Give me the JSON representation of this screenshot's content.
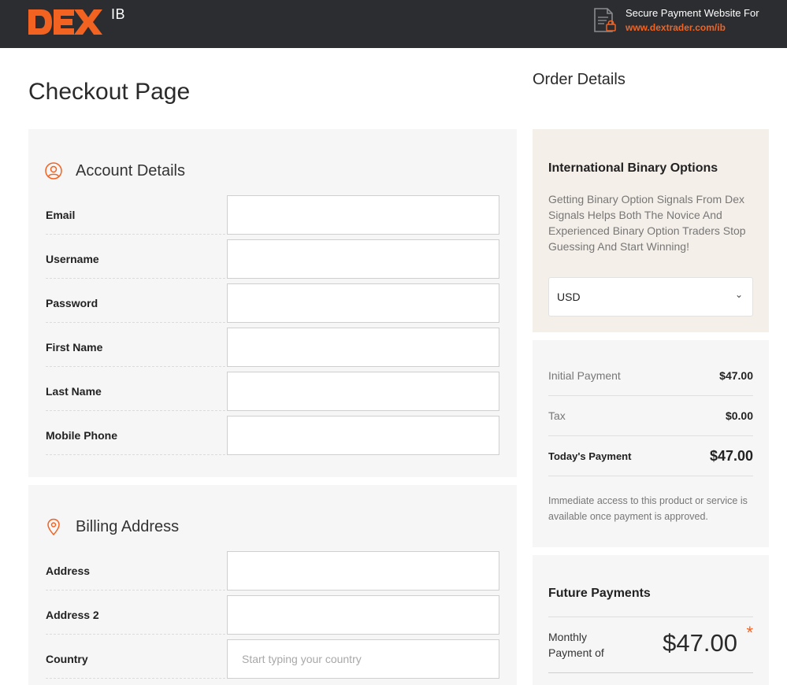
{
  "header": {
    "logo_text": "DEX",
    "logo_sub": "IB",
    "secure_text": "Secure Payment Website For",
    "secure_url": "www.dextrader.com/ib",
    "accent_color": "#f26322"
  },
  "page": {
    "title": "Checkout Page",
    "order_title": "Order Details"
  },
  "account": {
    "heading": "Account Details",
    "icon": "user-circle-icon",
    "fields": [
      {
        "label": "Email",
        "value": "",
        "placeholder": ""
      },
      {
        "label": "Username",
        "value": "",
        "placeholder": ""
      },
      {
        "label": "Password",
        "value": "",
        "placeholder": ""
      },
      {
        "label": "First Name",
        "value": "",
        "placeholder": ""
      },
      {
        "label": "Last Name",
        "value": "",
        "placeholder": ""
      },
      {
        "label": "Mobile Phone",
        "value": "",
        "placeholder": ""
      }
    ]
  },
  "billing": {
    "heading": "Billing Address",
    "icon": "map-pin-icon",
    "fields": [
      {
        "label": "Address",
        "value": "",
        "placeholder": ""
      },
      {
        "label": "Address 2",
        "value": "",
        "placeholder": ""
      },
      {
        "label": "Country",
        "value": "",
        "placeholder": "Start typing your country"
      }
    ]
  },
  "product": {
    "name": "International Binary Options",
    "description": "Getting Binary Option Signals From Dex Signals Helps Both The Novice And Experienced Binary Option Traders Stop Guessing And Start Winning!",
    "currency": "USD",
    "chevron": "⌄"
  },
  "summary": {
    "rows": [
      {
        "label": "Initial Payment",
        "value": "$47.00"
      },
      {
        "label": "Tax",
        "value": "$0.00"
      },
      {
        "label": "Today's Payment",
        "value": "$47.00"
      }
    ],
    "note": "Immediate access to this product or service is available once payment is approved."
  },
  "future": {
    "title": "Future Payments",
    "label": "Monthly Payment of",
    "amount": "$47.00",
    "star": "*"
  }
}
